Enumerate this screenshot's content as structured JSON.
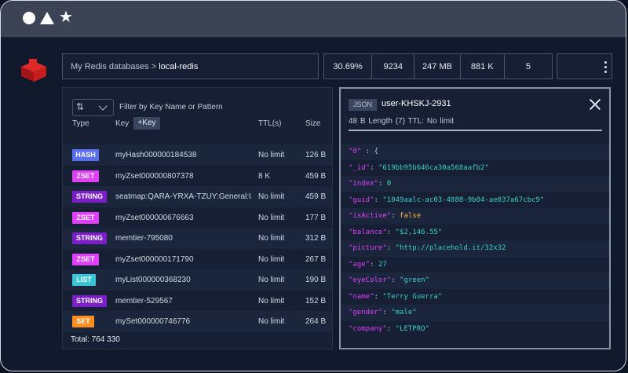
{
  "window": {
    "controls": [
      "circle",
      "triangle",
      "star"
    ]
  },
  "logo": "redis-logo-icon",
  "breadcrumb": {
    "parent": "My Redis databases",
    "separator": ">",
    "current": "local-redis"
  },
  "stats": [
    "30.69%",
    "9234",
    "247 MB",
    "881 K",
    "5"
  ],
  "keys_panel": {
    "filter_placeholder": "Filter by Key Name or Pattern",
    "columns": {
      "type": "Type",
      "key": "Key",
      "add_key": "+Key",
      "ttl": "TTL(s)",
      "size": "Size"
    },
    "rows": [
      {
        "type": "HASH",
        "color": "#5a6ff0",
        "name": "myHash000000184538",
        "ttl": "No limit",
        "size": "126 B"
      },
      {
        "type": "ZSET",
        "color": "#e040fb",
        "name": "myZset000000807378",
        "ttl": "8 K",
        "size": "459 B"
      },
      {
        "type": "STRING",
        "color": "#7b1fcb",
        "name": "seatmap:QARA-YRXA-TZUY:General:UF",
        "ttl": "No limit",
        "size": "459 B"
      },
      {
        "type": "ZSET",
        "color": "#e040fb",
        "name": "myZset000000676663",
        "ttl": "No limit",
        "size": "177 B"
      },
      {
        "type": "STRING",
        "color": "#7b1fcb",
        "name": "memtier-795080",
        "ttl": "No limit",
        "size": "312 B"
      },
      {
        "type": "ZSET",
        "color": "#e040fb",
        "name": "myZset000000171790",
        "ttl": "No limit",
        "size": "267 B"
      },
      {
        "type": "LIST",
        "color": "#39c6d6",
        "name": "myList000000368230",
        "ttl": "No limit",
        "size": "190 B"
      },
      {
        "type": "STRING",
        "color": "#7b1fcb",
        "name": "memtier-529567",
        "ttl": "No limit",
        "size": "152 B"
      },
      {
        "type": "SET",
        "color": "#ff8f1f",
        "name": "mySet000000746776",
        "ttl": "No limit",
        "size": "264 B"
      }
    ],
    "total": "Total: 764 330"
  },
  "detail": {
    "type": "JSON",
    "key": "user-KHSKJ-2931",
    "meta": "48 B    Length (7)    TTL: No limit",
    "json_lines": [
      {
        "k": "\"0\"",
        "sep": " : ",
        "v": "{",
        "vt": "plain"
      },
      {
        "k": "\"_id\"",
        "sep": ": ",
        "v": "\"619bb95b646ca30a568aafb2\"",
        "vt": "string"
      },
      {
        "k": "\"index\"",
        "sep": ": ",
        "v": "0",
        "vt": "number"
      },
      {
        "k": "\"guid\"",
        "sep": ": ",
        "v": "\"1049aalc-ac03-4888-9b04-ae037a67cbc9\"",
        "vt": "string"
      },
      {
        "k": "\"isActive\"",
        "sep": ": ",
        "v": "false",
        "vt": "bool"
      },
      {
        "k": "\"balance\"",
        "sep": ": ",
        "v": "\"$2,146.55\"",
        "vt": "string"
      },
      {
        "k": "\"picture\"",
        "sep": ": ",
        "v": "\"http://placehold.it/32x32",
        "vt": "string"
      },
      {
        "k": "\"age\"",
        "sep": ": ",
        "v": "27",
        "vt": "number"
      },
      {
        "k": "\"eyeColor\"",
        "sep": ": ",
        "v": "\"green\"",
        "vt": "string"
      },
      {
        "k": "\"name\"",
        "sep": ": ",
        "v": "\"Terry Guerra\"",
        "vt": "string"
      },
      {
        "k": "\"gender\"",
        "sep": ": ",
        "v": "\"male\"",
        "vt": "string"
      },
      {
        "k": "\"company\"",
        "sep": ": ",
        "v": "\"LETPRO\"",
        "vt": "string"
      }
    ]
  }
}
